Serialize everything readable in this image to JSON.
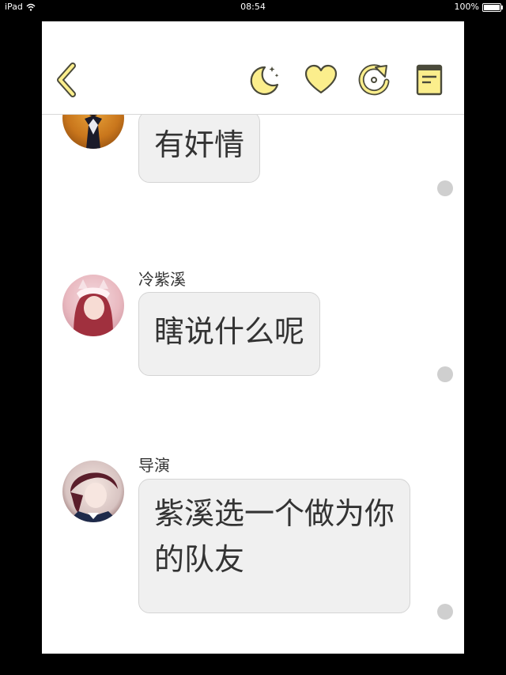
{
  "status_bar": {
    "device": "iPad",
    "time": "08:54",
    "battery": "100%"
  },
  "toolbar": {
    "icons": [
      "back-icon",
      "moon-icon",
      "heart-icon",
      "refresh-icon",
      "book-icon"
    ],
    "accent_color": "#FBEE8C",
    "stroke_color": "#4a4a3a"
  },
  "messages": [
    {
      "sender": "",
      "text": "有奸情"
    },
    {
      "sender": "冷紫溪",
      "text": "瞎说什么呢"
    },
    {
      "sender": "导演",
      "text_line1": "紫溪选一个做为你",
      "text_line2": "的队友"
    }
  ]
}
